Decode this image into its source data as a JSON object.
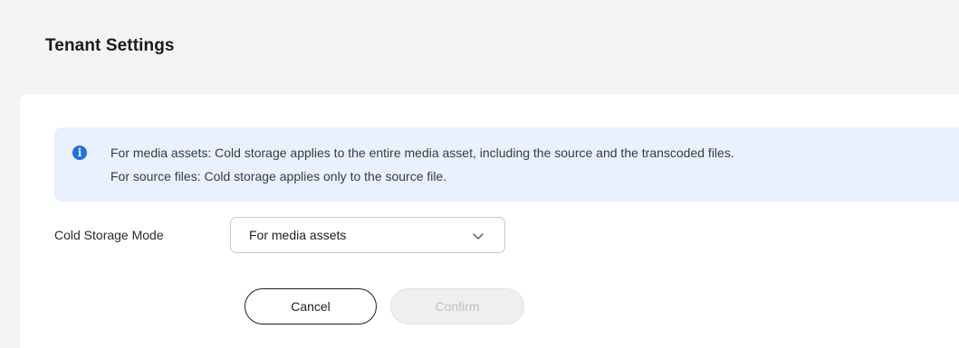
{
  "page": {
    "title": "Tenant Settings"
  },
  "notice": {
    "icon": "info-icon",
    "line1": "For media assets: Cold storage applies to the entire media asset, including the source and the transcoded files.",
    "line2": "For source files: Cold storage applies only to the source file."
  },
  "form": {
    "cold_storage_mode_label": "Cold Storage Mode",
    "cold_storage_mode_value": "For media assets"
  },
  "actions": {
    "cancel_label": "Cancel",
    "confirm_label": "Confirm",
    "confirm_disabled": true
  },
  "colors": {
    "accent": "#1f70e0",
    "notice_background": "#e8f1fd",
    "page_background": "#f4f4f5"
  }
}
